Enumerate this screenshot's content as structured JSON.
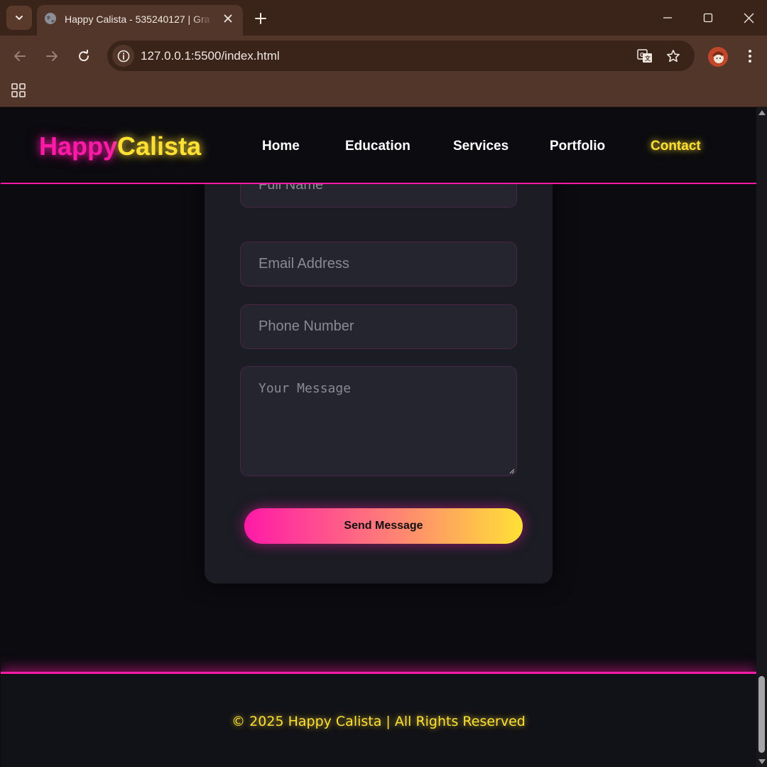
{
  "browser": {
    "tab_title": "Happy Calista - 535240127 | Gra",
    "url": "127.0.0.1:5500/index.html",
    "icons": {
      "tab_search": "chevron-down-icon",
      "favicon": "globe-icon",
      "tab_close": "close-icon",
      "new_tab": "plus-icon",
      "minimize": "minimize-icon",
      "maximize": "maximize-icon",
      "window_close": "close-icon",
      "back": "arrow-left-icon",
      "forward": "arrow-right-icon",
      "reload": "reload-icon",
      "site_info": "info-icon",
      "translate": "translate-icon",
      "bookmark": "star-icon",
      "profile": "avatar",
      "menu": "kebab-menu-icon",
      "apps": "apps-grid-icon"
    }
  },
  "site": {
    "logo_part1": "Happy",
    "logo_part2": "Calista",
    "nav": [
      {
        "label": "Home"
      },
      {
        "label": "Education"
      },
      {
        "label": "Services"
      },
      {
        "label": "Portfolio"
      },
      {
        "label": "Contact",
        "active": true
      }
    ],
    "form": {
      "full_name_placeholder": "Full Name",
      "email_placeholder": "Email Address",
      "phone_placeholder": "Phone Number",
      "message_placeholder": "Your Message",
      "submit_label": "Send Message"
    },
    "footer_text": "© 2025 Happy Calista | All Rights Reserved",
    "colors": {
      "accent_pink": "#ff1aa8",
      "accent_yellow": "#ffe135",
      "background": "#0b0b10",
      "card": "#1b1c24",
      "input": "#24252e"
    }
  }
}
